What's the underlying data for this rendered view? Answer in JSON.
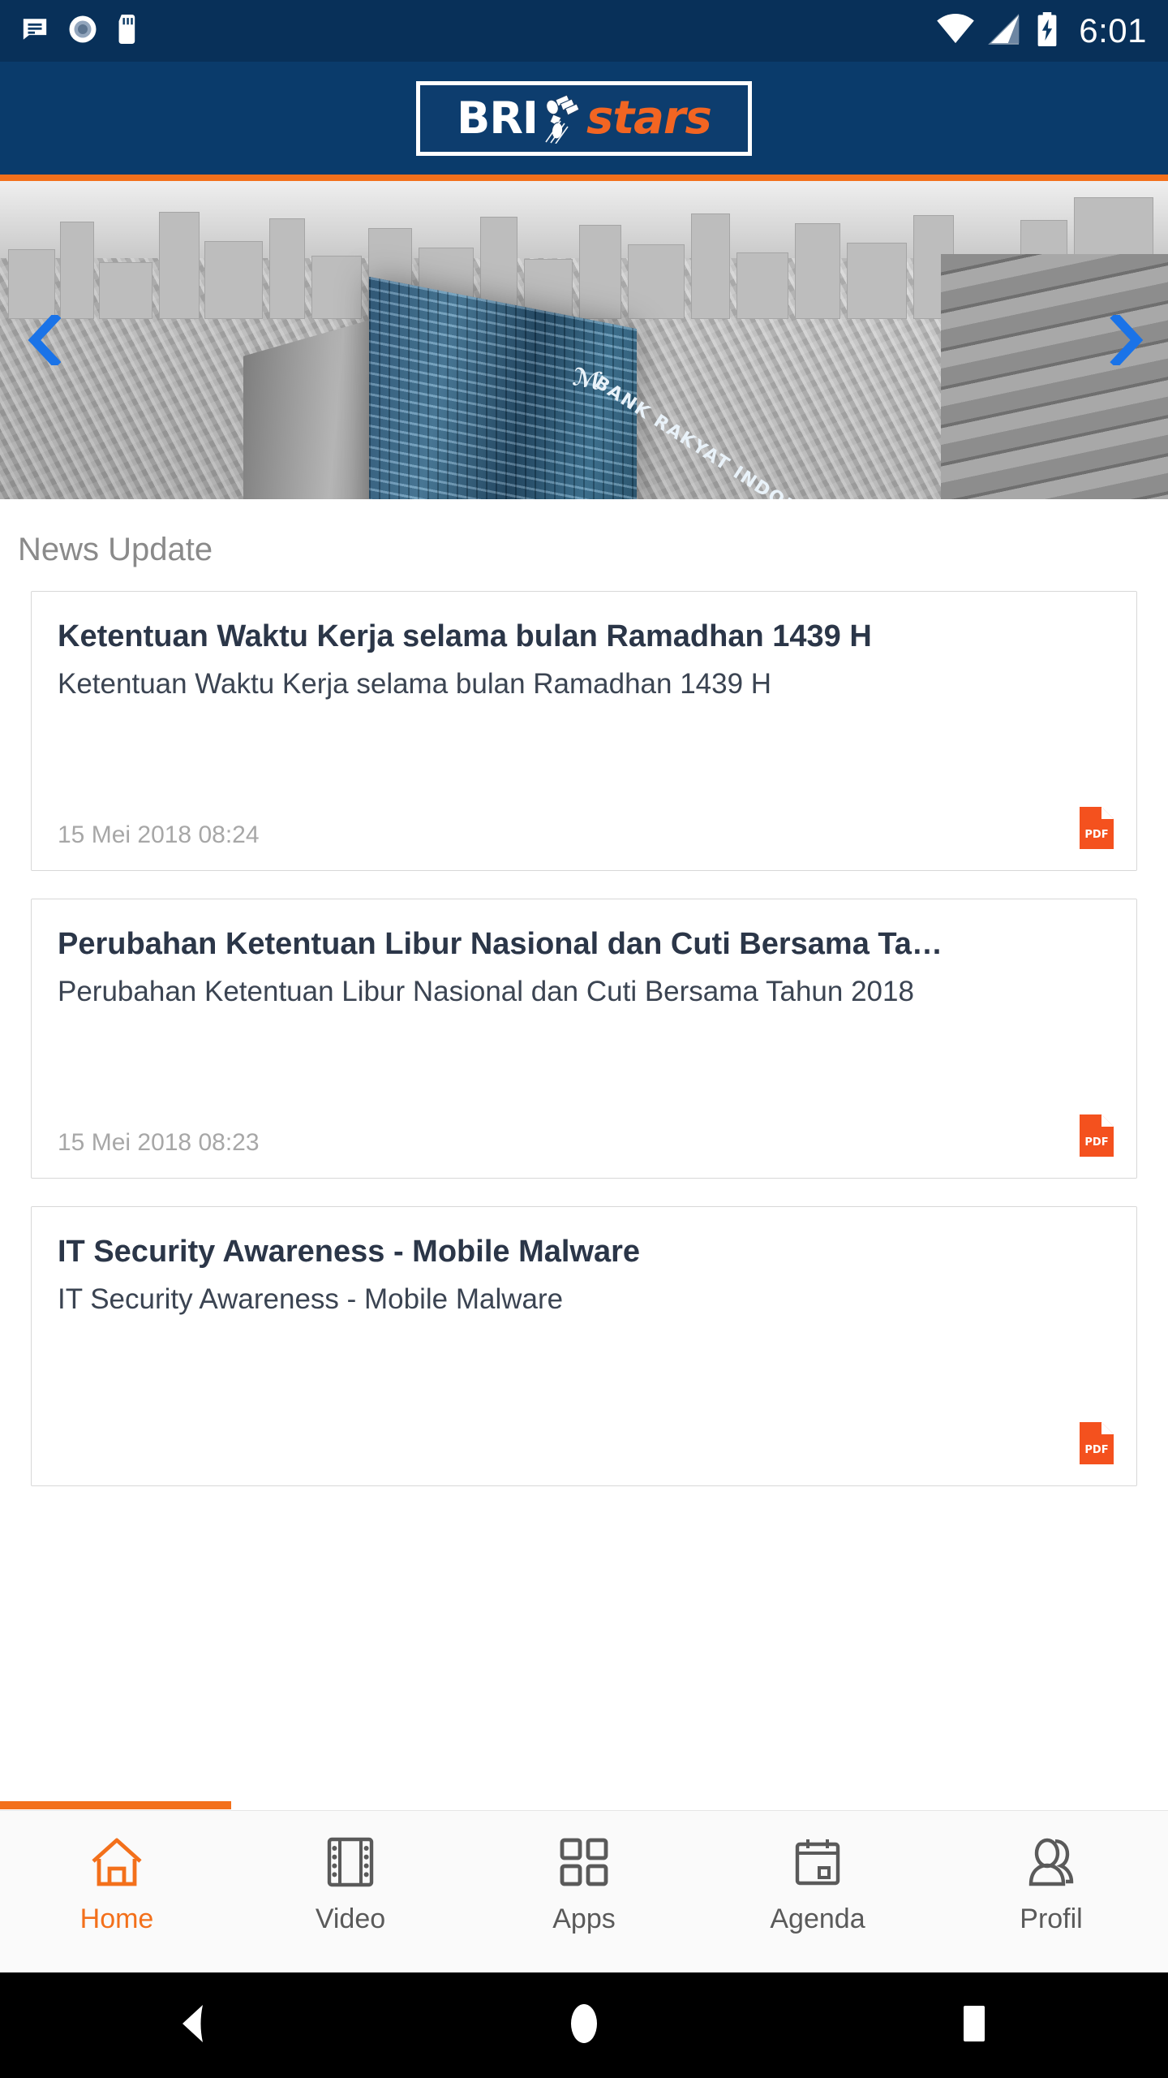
{
  "status_bar": {
    "time": "6:01",
    "left_icons": [
      "message-icon",
      "record-circle-icon",
      "sd-card-icon"
    ],
    "right_icons": [
      "wifi-icon",
      "cellular-signal-icon",
      "battery-charging-icon"
    ]
  },
  "header": {
    "logo_text_primary": "BRI",
    "logo_text_secondary": "stars",
    "accent_color": "#F3701B",
    "background_color": "#0a3b6b"
  },
  "carousel": {
    "prev_label": "‹",
    "next_label": "›",
    "indicator_color": "#1A73E8",
    "slide_alt": "BRI headquarters tower aerial view"
  },
  "news": {
    "section_title": "News Update",
    "items": [
      {
        "title": "Ketentuan Waktu Kerja selama bulan Ramadhan 1439 H",
        "subtitle": "Ketentuan Waktu Kerja selama bulan Ramadhan 1439 H",
        "date": "15 Mei 2018 08:24",
        "attachment": "PDF"
      },
      {
        "title": "Perubahan Ketentuan Libur Nasional dan Cuti Bersama Ta…",
        "subtitle": "Perubahan Ketentuan Libur Nasional dan Cuti Bersama Tahun 2018",
        "date": "15 Mei 2018 08:23",
        "attachment": "PDF"
      },
      {
        "title": "IT Security Awareness - Mobile Malware",
        "subtitle": "IT Security Awareness - Mobile Malware",
        "date": "",
        "attachment": "PDF"
      }
    ]
  },
  "bottom_nav": {
    "active_index": 0,
    "active_color": "#F3701B",
    "inactive_color": "#5a5a5a",
    "items": [
      {
        "label": "Home",
        "icon": "home-icon"
      },
      {
        "label": "Video",
        "icon": "film-strip-icon"
      },
      {
        "label": "Apps",
        "icon": "grid-icon"
      },
      {
        "label": "Agenda",
        "icon": "calendar-icon"
      },
      {
        "label": "Profil",
        "icon": "person-icon"
      }
    ]
  },
  "system_nav": {
    "back": "back-triangle-icon",
    "home": "home-circle-icon",
    "recents": "recents-square-icon"
  }
}
